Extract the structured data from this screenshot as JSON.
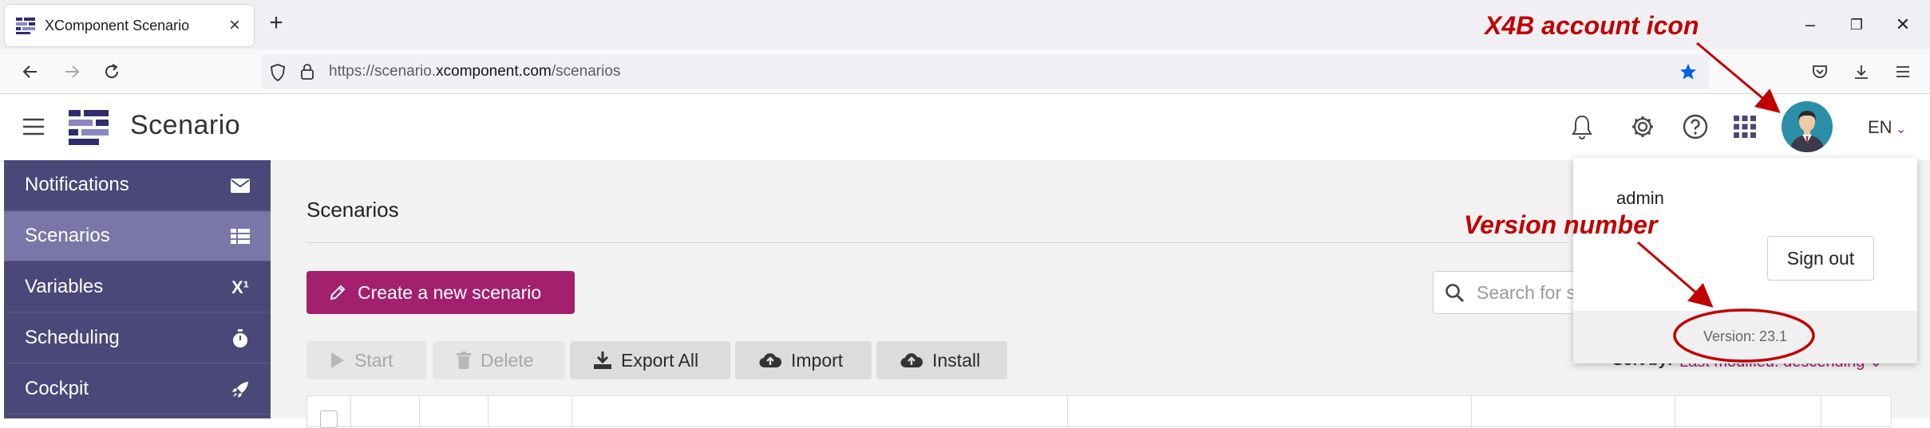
{
  "browser": {
    "tab_title": "XComponent Scenario",
    "close_glyph": "×",
    "new_tab_glyph": "+",
    "url_prefix": "https://scenario.",
    "url_domain": "xcomponent.com",
    "url_path": "/scenarios",
    "window_controls": [
      "–",
      "❐",
      "✕"
    ]
  },
  "app": {
    "title": "Scenario",
    "language": "EN",
    "header_icons": [
      "bell-icon",
      "gear-icon",
      "help-icon",
      "apps-grid-icon"
    ]
  },
  "sidebar": {
    "items": [
      {
        "label": "Notifications",
        "icon": "envelope-icon",
        "active": false
      },
      {
        "label": "Scenarios",
        "icon": "table-icon",
        "active": true
      },
      {
        "label": "Variables",
        "icon": "x-superscript-icon",
        "active": false
      },
      {
        "label": "Scheduling",
        "icon": "stopwatch-icon",
        "active": false
      },
      {
        "label": "Cockpit",
        "icon": "rocket-icon",
        "active": false
      }
    ],
    "variables_icon_text": "X¹"
  },
  "main": {
    "title": "Scenarios",
    "create_button": "Create a new scenario",
    "search_placeholder": "Search for s",
    "toolbar": {
      "start": "Start",
      "delete": "Delete",
      "export_all": "Export All",
      "import": "Import",
      "install": "Install"
    },
    "sort_label": "Sort by:",
    "sort_value": "Last modified: descending ⌄"
  },
  "user_menu": {
    "username": "admin",
    "sign_out": "Sign out",
    "version": "Version: 23.1"
  },
  "annotations": {
    "account_icon": "X4B account icon",
    "version_number": "Version number",
    "color": "#c00000"
  },
  "colors": {
    "sidebar": "#4a4878",
    "sidebar_active": "#7a77a8",
    "accent": "#a2206d"
  }
}
